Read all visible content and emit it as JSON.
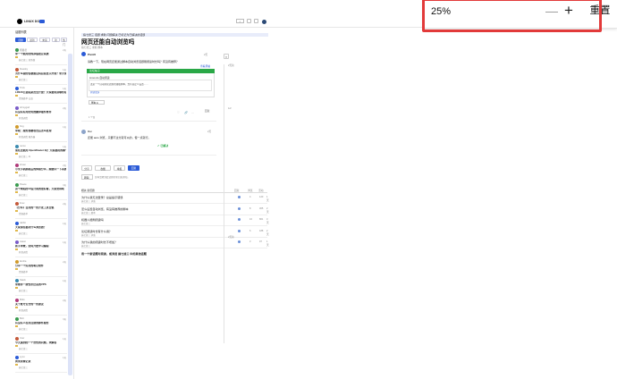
{
  "zoom": {
    "value": "25%",
    "minus": "—",
    "plus": "+",
    "reset": "重置"
  },
  "header": {
    "logo_text": "LINUX DO",
    "search_label": "搜索"
  },
  "sidebar": {
    "title": "话题列表",
    "tabs": [
      "话题",
      "最新",
      "未读",
      "新",
      "热门"
    ],
    "items": [
      {
        "author": "熊猫君",
        "date": "2天",
        "title": "求一个能用的纯净版稳定系统",
        "tags": "搞七捻三 纯净版"
      },
      {
        "author": "bluesky",
        "date": "1天",
        "title": "为什么我的谷歌验证码总是显示异常？求大佬帮忙看看",
        "tags": "搞七捻三"
      },
      {
        "author": "Trick",
        "date": "1天",
        "title": "LINUX公益站是否会开放？大家都知道哪些站点",
        "tags": "资源荟萃 公益"
      },
      {
        "author": "ohmygod",
        "date": "2天",
        "title": "有没有好用的免费翻译插件推荐",
        "tags": "开发调优"
      },
      {
        "author": "frog",
        "date": "1天",
        "title": "求助：服务器被攻击后怎么处理",
        "tags": "开发调优 服务器"
      },
      {
        "author": "nemo",
        "date": "1天",
        "title": "现在还能用 OpenRouter 吗？大家都用的哪个模型",
        "tags": "搞七捻三 AI"
      },
      {
        "author": "shuai",
        "date": "2天",
        "title": "小米手机刷机后的体验分享，顺便问一下系统选择",
        "tags": "搞七捻三"
      },
      {
        "author": "Peace",
        "date": "3天",
        "title": "这个网站的UI设计真的很好看，大家觉得呢",
        "tags": "搞七捻三"
      },
      {
        "author": "linux",
        "date": "2天",
        "title": "【分享】自用的一些开发工具合集",
        "tags": "资源荟萃"
      },
      {
        "author": "rabbit",
        "date": "1天",
        "title": "大家现在都用什么浏览器？",
        "tags": "搞七捻三"
      },
      {
        "author": "Jason",
        "date": "1天",
        "title": "新手求教，如何开始学习编程",
        "tags": "开发调优"
      },
      {
        "author": "Emilia",
        "date": "2天",
        "title": "分享一个好用的笔记软件",
        "tags": "资源荟萃"
      },
      {
        "author": "Stack",
        "date": "1天",
        "title": "求推荐一款性价比高的VPS",
        "tags": "搞七捻三"
      },
      {
        "author": "Miko",
        "date": "2天",
        "title": "关于账号安全的一些建议",
        "tags": "开发调优"
      },
      {
        "author": "Bolt",
        "date": "3天",
        "title": "有没有人在用自建的邮件服务",
        "tags": "搞七捻三"
      },
      {
        "author": "river",
        "date": "1天",
        "title": "今天遇到的一个奇怪的问题，求解答",
        "tags": "搞七捻三"
      },
      {
        "author": "Lynn",
        "date": "1天",
        "title": "周末折腾记录",
        "tags": "搞七捻三"
      }
    ]
  },
  "topic": {
    "breadcrumb": "搞七捻三  话题  求助  问题解决 已标记为已解决的话题",
    "title": "网页还能自动浏览吗",
    "meta": "搞七捻三  求助  脚本",
    "post1": {
      "user": "Pivot0",
      "date": "2天",
      "body": "请教一下，现在网页还能通过脚本自动浏览话题刷阅读时长吗？有没有推荐？",
      "link": "查看原帖",
      "embed_head": "论坛帖子",
      "embed_line1": "Linux.do  自动阅读",
      "embed_line2": "这是一个自动阅读话题的油猴脚本，支持自定义设置……",
      "embed_line3": "阅读更多",
      "file": "脚本.js",
      "likes": "1 个赞",
      "reply": "回复"
    },
    "post2": {
      "user": "Rai",
      "date": "2天",
      "body": "还能 auto 浏览，只要不过分就可以的，慢一点就行。",
      "solved": "✔ 已解决"
    },
    "controls": {
      "share": "分享",
      "bookmark": "收藏",
      "flag": "举报",
      "reply": "回复",
      "track": "跟踪",
      "track_text": "您将会收到此话题的新回复通知。"
    }
  },
  "related": {
    "tabs": "相关  新话题",
    "cols": [
      "回复",
      "浏览",
      "活动"
    ],
    "rows": [
      {
        "title": "为什么我无法登录？总是提示错误",
        "tags": "搞七捻三 求助",
        "replies": "4",
        "views": "120",
        "act": "1天"
      },
      {
        "title": "怎么设置自动浏览，有没有推荐的脚本",
        "tags": "搞七捻三 脚本",
        "replies": "8",
        "views": "305",
        "act": "2天"
      },
      {
        "title": "机器人能刷阅读吗",
        "tags": "搞七捻三",
        "replies": "16",
        "views": "861",
        "act": "3天"
      },
      {
        "title": "论坛阅读时长有什么用？",
        "tags": "搞七捻三 求助",
        "replies": "6",
        "views": "188",
        "act": "2天"
      },
      {
        "title": "为什么我的阅读时长不增加？",
        "tags": "搞七捻三",
        "replies": "3",
        "views": "97",
        "act": "1天"
      }
    ],
    "suggest": "有一个新话题可阅读，或浏览 搞七捻三 中的其他话题"
  },
  "timeline": {
    "top": "1/2",
    "date1": "2天前",
    "date2": "2天前"
  }
}
